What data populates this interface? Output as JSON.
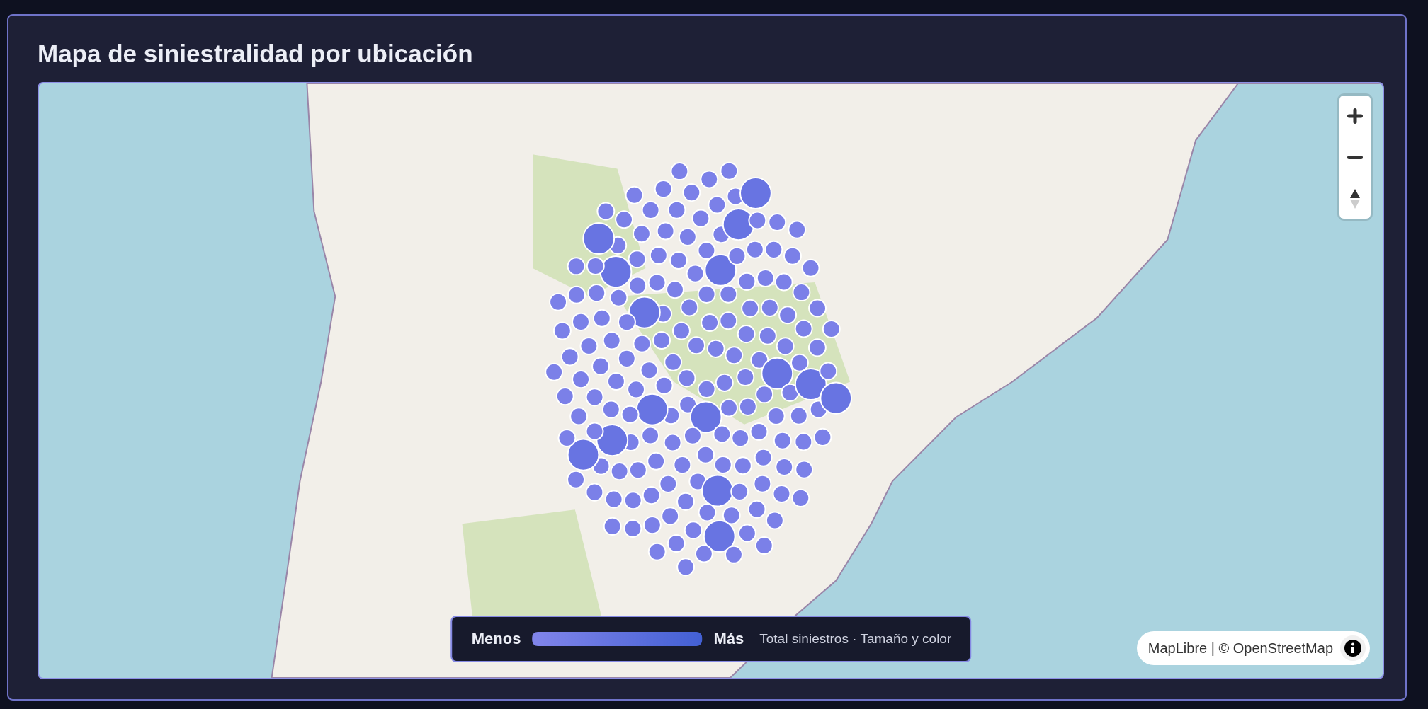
{
  "card": {
    "title": "Mapa de siniestralidad por ubicación"
  },
  "map": {
    "legend": {
      "min_label": "Menos",
      "max_label": "Más",
      "caption": "Total siniestros · Tamaño y color"
    },
    "attribution": "MapLibre | © OpenStreetMap"
  }
}
